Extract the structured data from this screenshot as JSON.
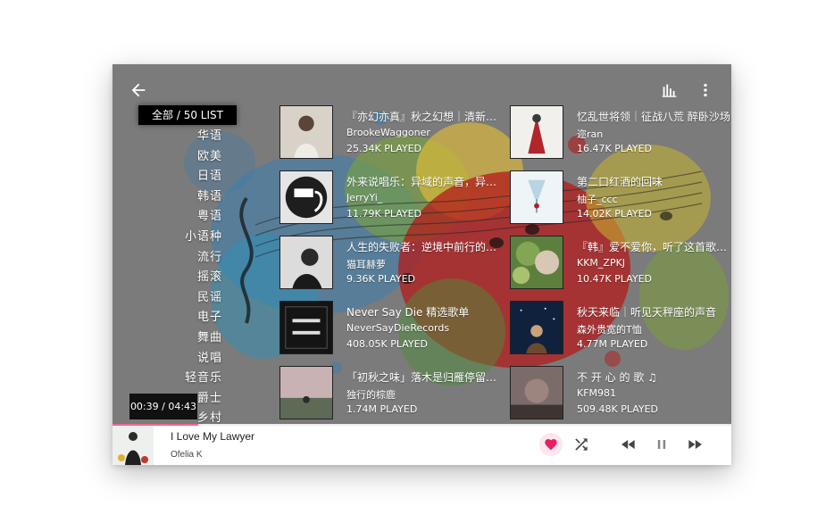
{
  "header": {
    "back_icon": "arrow-left-icon",
    "chart_icon": "bar-chart-icon",
    "more_icon": "more-vertical-icon"
  },
  "categories": {
    "all_label": "全部 / 50 LIST",
    "items": [
      "华语",
      "欧美",
      "日语",
      "韩语",
      "粤语",
      "小语种",
      "流行",
      "摇滚",
      "民谣",
      "电子",
      "舞曲",
      "说唱",
      "轻音乐",
      "爵士",
      "乡村"
    ]
  },
  "playlists": [
    {
      "title": "『亦幻亦真』秋之幻想｜清新之境",
      "author": "BrookeWaggoner",
      "plays": "25.34K PLAYED"
    },
    {
      "title": "忆乱世将领｜征战八荒 醉卧沙场",
      "author": "迩ran",
      "plays": "16.47K PLAYED"
    },
    {
      "title": "外来说唱乐：异域的声音，异域的态度",
      "author": "JerryYi_",
      "plays": "11.79K PLAYED"
    },
    {
      "title": "第二口红酒的回味",
      "author": "柚子_ccc",
      "plays": "14.02K PLAYED"
    },
    {
      "title": "人生的失败者：逆境中前行的力量",
      "author": "猫耳赫萝",
      "plays": "9.36K PLAYED"
    },
    {
      "title": "『韩』爱不爱你，听了这首歌就知道",
      "author": "KKM_ZPKJ",
      "plays": "10.47K PLAYED"
    },
    {
      "title": "Never Say Die 精选歌单",
      "author": "NeverSayDieRecords",
      "plays": "408.05K PLAYED"
    },
    {
      "title": "秋天来临｜听见天秤座的声音",
      "author": "森外贵宽的T恤",
      "plays": "4.77M PLAYED"
    },
    {
      "title": "「初秋之味」落木是归雁停留的地方",
      "author": "独行的棕鹿",
      "plays": "1.74M PLAYED"
    },
    {
      "title": "不 开 心 的 歌 ♫",
      "author": "KFM981",
      "plays": "509.48K PLAYED"
    }
  ],
  "player": {
    "time": "00:39 / 04:43",
    "progress_fraction": 0.138,
    "title": "I Love My Lawyer",
    "artist": "Ofelia K",
    "liked": true,
    "accent": "#e91e63",
    "icons": [
      "heart-icon",
      "shuffle-icon",
      "rewind-icon",
      "pause-icon",
      "fast-forward-icon"
    ]
  }
}
